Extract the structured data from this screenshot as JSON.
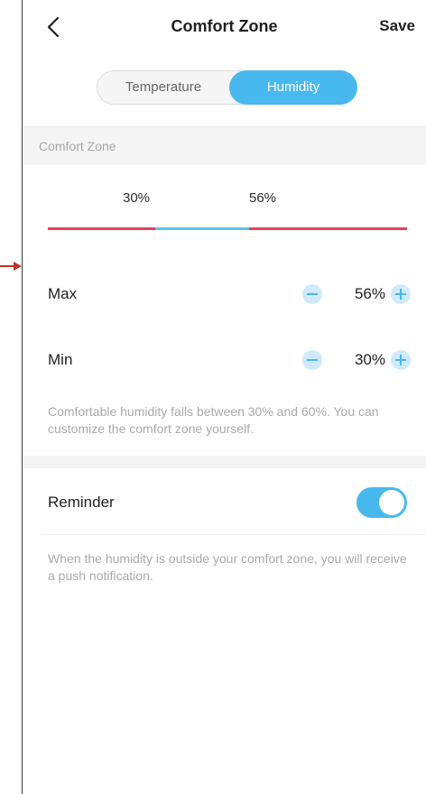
{
  "header": {
    "title": "Comfort Zone",
    "save_label": "Save"
  },
  "tabs": {
    "items": [
      {
        "label": "Temperature",
        "selected": false
      },
      {
        "label": "Humidity",
        "selected": true
      }
    ]
  },
  "comfort_zone": {
    "section_label": "Comfort Zone",
    "range": {
      "min_label": "30%",
      "max_label": "56%",
      "min_value": 30,
      "max_value": 56,
      "scale_min": 0,
      "scale_max": 100
    },
    "max_row": {
      "label": "Max",
      "value": "56%"
    },
    "min_row": {
      "label": "Min",
      "value": "30%"
    },
    "note": "Comfortable humidity falls between 30% and 60%. You can customize the comfort zone yourself."
  },
  "reminder": {
    "label": "Reminder",
    "enabled": true,
    "note": "When the humidity is outside your comfort zone, you will receive a push notification."
  },
  "colors": {
    "accent": "#48b9ee",
    "out_of_range": "#e8405a",
    "in_range": "#5cc2f0"
  }
}
